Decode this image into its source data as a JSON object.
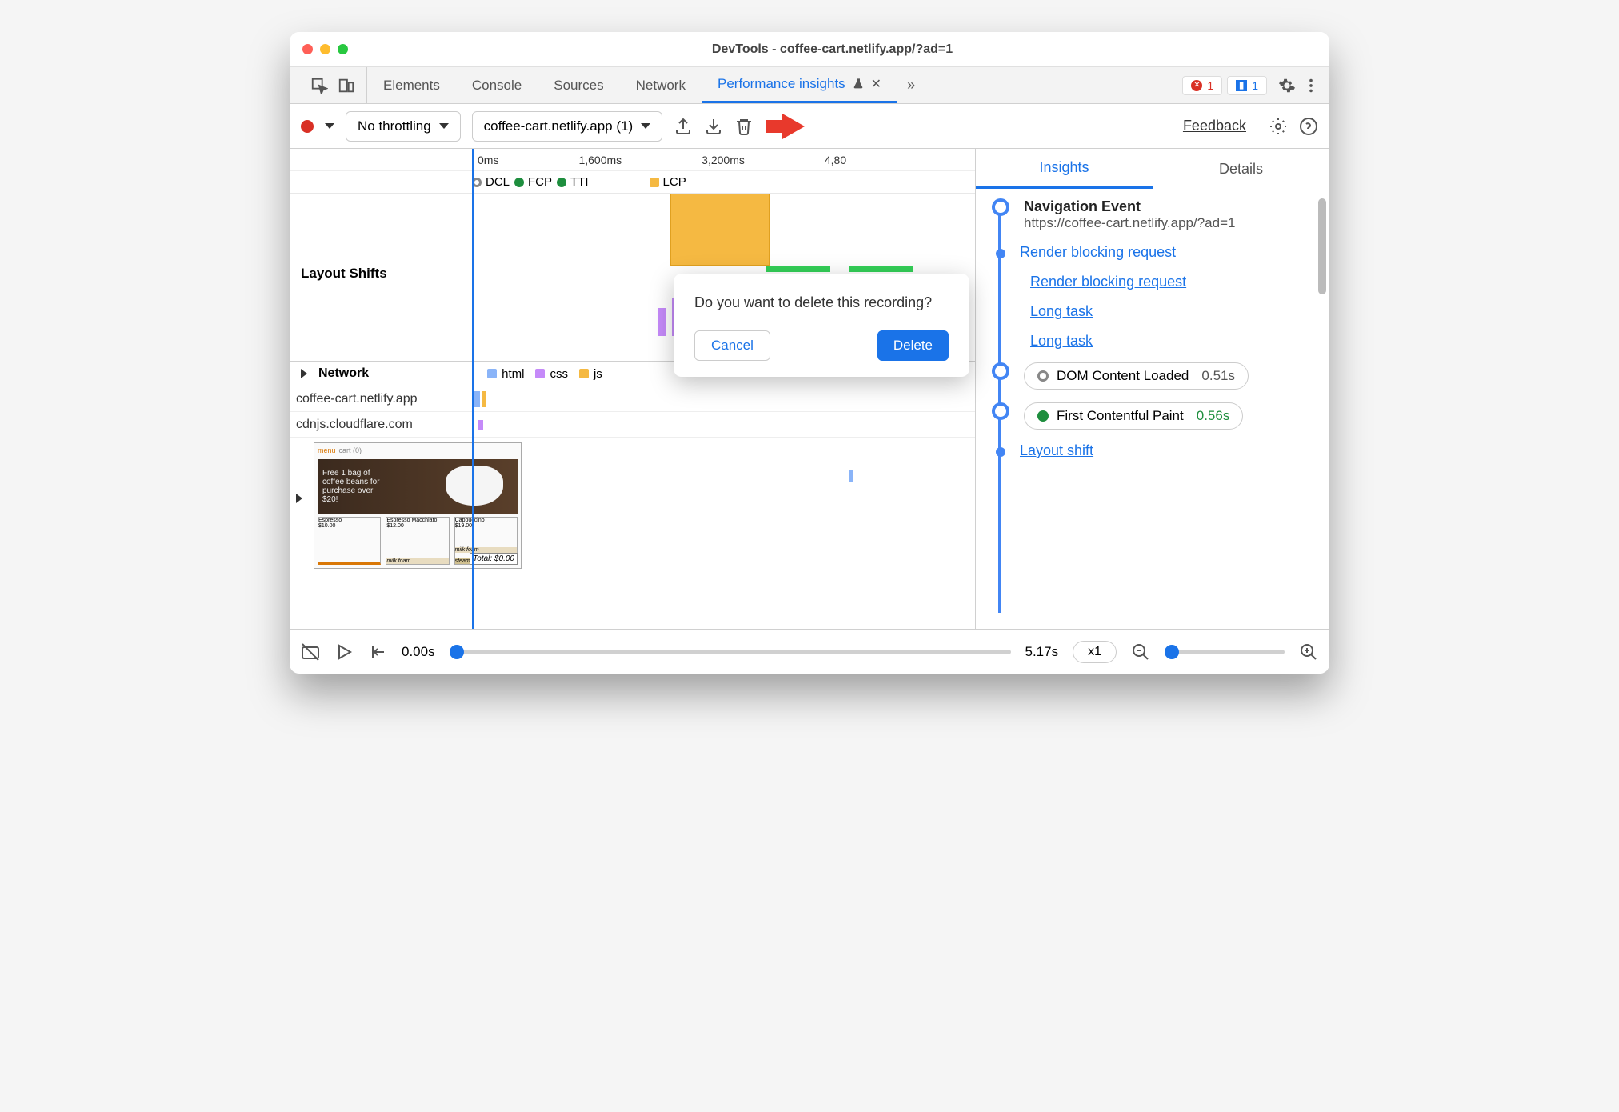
{
  "window": {
    "title": "DevTools - coffee-cart.netlify.app/?ad=1"
  },
  "tabs": {
    "items": [
      "Elements",
      "Console",
      "Sources",
      "Network",
      "Performance insights"
    ],
    "active_index": 4
  },
  "status": {
    "errors": "1",
    "info": "1"
  },
  "toolbar": {
    "throttling": "No throttling",
    "recording_name": "coffee-cart.netlify.app (1)",
    "feedback": "Feedback"
  },
  "timeline": {
    "ticks": [
      "0ms",
      "1,600ms",
      "3,200ms",
      "4,80"
    ],
    "markers": [
      {
        "label": "DCL",
        "color": "#fff",
        "ring": "#888"
      },
      {
        "label": "FCP",
        "color": "#1e8e3e"
      },
      {
        "label": "TTI",
        "color": "#1e8e3e"
      },
      {
        "label": "LCP",
        "color": "#f5b942"
      }
    ],
    "layout_shifts_label": "Layout Shifts"
  },
  "network": {
    "title": "Network",
    "legend": [
      {
        "label": "html",
        "color": "#8ab4f8"
      },
      {
        "label": "css",
        "color": "#c58af9"
      },
      {
        "label": "js",
        "color": "#f5b942"
      }
    ],
    "rows": [
      "coffee-cart.netlify.app",
      "cdnjs.cloudflare.com"
    ]
  },
  "thumbnail": {
    "menu": "menu",
    "cart": "cart (0)",
    "banner_text": "Free 1 bag of coffee beans for purchase over $20!",
    "products": [
      {
        "name": "Espresso",
        "price": "$10.00"
      },
      {
        "name": "Espresso Macchiato",
        "price": "$12.00"
      },
      {
        "name": "Cappuccino",
        "price": "$19.00"
      }
    ],
    "milk_foam": "milk foam",
    "steamed": "steamed",
    "total": "Total: $0.00"
  },
  "scrubber": {
    "start": "0.00s",
    "end": "5.17s",
    "speed": "x1"
  },
  "right": {
    "tabs": [
      "Insights",
      "Details"
    ],
    "active_index": 0,
    "nav_event": {
      "title": "Navigation Event",
      "url": "https://coffee-cart.netlify.app/?ad=1"
    },
    "items": [
      {
        "type": "link",
        "text": "Render blocking request"
      },
      {
        "type": "link",
        "text": "Render blocking request"
      },
      {
        "type": "link",
        "text": "Long task"
      },
      {
        "type": "link",
        "text": "Long task"
      },
      {
        "type": "pill",
        "label": "DOM Content Loaded",
        "time": "0.51s",
        "dot": "#fff",
        "ring": "#888"
      },
      {
        "type": "pill",
        "label": "First Contentful Paint",
        "time": "0.56s",
        "dot": "#1e8e3e",
        "time_class": "green"
      },
      {
        "type": "link",
        "text": "Layout shift"
      }
    ]
  },
  "dialog": {
    "text": "Do you want to delete this recording?",
    "cancel": "Cancel",
    "delete": "Delete"
  }
}
